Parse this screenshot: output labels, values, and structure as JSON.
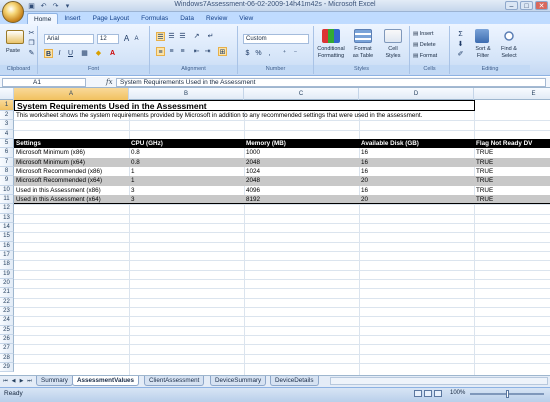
{
  "window": {
    "title": "Windows7Assessment-06-02-2009-14h41m42s - Microsoft Excel",
    "minimize": "–",
    "maximize": "□",
    "close": "✕"
  },
  "quick_access": {
    "save_icon": "save-icon",
    "undo_icon": "undo-icon",
    "redo_icon": "redo-icon"
  },
  "ribbon": {
    "tabs": [
      "Home",
      "Insert",
      "Page Layout",
      "Formulas",
      "Data",
      "Review",
      "View"
    ],
    "active_tab": "Home",
    "clipboard": {
      "paste_label": "Paste",
      "group_label": "Clipboard"
    },
    "font": {
      "name": "Arial",
      "size": "12",
      "group_label": "Font",
      "bold": "B",
      "italic": "I",
      "underline": "U",
      "grow": "A",
      "shrink": "A"
    },
    "alignment": {
      "group_label": "Alignment"
    },
    "number": {
      "format": "Custom",
      "currency": "$",
      "percent": "%",
      "comma": ",",
      "group_label": "Number"
    },
    "styles": {
      "conditional_formatting": [
        "Conditional",
        "Formatting"
      ],
      "format_as_table": [
        "Format",
        "as Table"
      ],
      "cell_styles": [
        "Cell",
        "Styles"
      ],
      "group_label": "Styles"
    },
    "cells": {
      "insert": "Insert",
      "delete": "Delete",
      "format": "Format",
      "group_label": "Cells"
    },
    "editing": {
      "sort_filter": [
        "Sort &",
        "Filter"
      ],
      "find_select": [
        "Find &",
        "Select"
      ],
      "sigma": "Σ",
      "group_label": "Editing"
    }
  },
  "formula_bar": {
    "name_box": "A1",
    "fx": "fx",
    "content": "System Requirements Used in the Assessment"
  },
  "sheet": {
    "columns": [
      "A",
      "B",
      "C",
      "D",
      "E"
    ],
    "rows": [
      "1",
      "2",
      "3",
      "4",
      "5",
      "6",
      "7",
      "8",
      "9",
      "10",
      "11",
      "12",
      "13",
      "14",
      "15",
      "16",
      "17",
      "18",
      "19",
      "20",
      "21",
      "22",
      "23",
      "24",
      "25",
      "26",
      "27",
      "28",
      "29",
      "30"
    ],
    "title": "System Requirements Used in the Assessment",
    "description": "This worksheet shows the system requirements provided by Microsoft in addition to any recommended settings that were used in the assessment.",
    "table_headers": [
      "Settings",
      "CPU (GHz)",
      "Memory (MB)",
      "Available Disk (GB)",
      "Flag Not Ready DV"
    ],
    "table_rows": [
      [
        "Microsoft Minimum (x86)",
        "0.8",
        "1000",
        "16",
        "TRUE"
      ],
      [
        "Microsoft Minimum (x64)",
        "0.8",
        "2048",
        "16",
        "TRUE"
      ],
      [
        "Microsoft Recommended (x86)",
        "1",
        "1024",
        "16",
        "TRUE"
      ],
      [
        "Microsoft Recommended (x64)",
        "1",
        "2048",
        "20",
        "TRUE"
      ],
      [
        "Used in this Assessment (x86)",
        "3",
        "4096",
        "16",
        "TRUE"
      ],
      [
        "Used in this Assessment (x64)",
        "3",
        "8192",
        "20",
        "TRUE"
      ]
    ]
  },
  "sheet_tabs": [
    "Summary",
    "AssessmentValues",
    "ClientAssessment",
    "DeviceSummary",
    "DeviceDetails"
  ],
  "active_sheet": "AssessmentValues",
  "status": {
    "text": "Ready",
    "zoom": "100%"
  }
}
